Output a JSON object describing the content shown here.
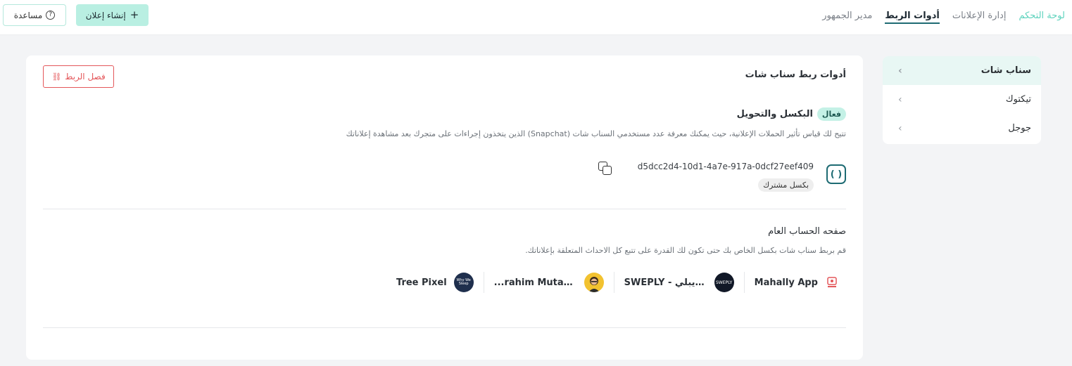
{
  "nav": {
    "items": [
      {
        "label": "لوحة التحكم"
      },
      {
        "label": "إدارة الإعلانات"
      },
      {
        "label": "أدوات الربط"
      },
      {
        "label": "مدير الجمهور"
      }
    ],
    "create_label": "إنشاء إعلان",
    "help_label": "مساعدة"
  },
  "sidebar": {
    "items": [
      {
        "label": "سناب شات"
      },
      {
        "label": "تيكتوك"
      },
      {
        "label": "جوجل"
      }
    ]
  },
  "panel": {
    "title": "أدوات ربط سناب شات",
    "unlink_label": "فصل الربط",
    "pixel": {
      "title": "البكسل والتحويل",
      "status": "فعال",
      "description": "تتيح لك قياس تأثير الحملات الإعلانية، حيث يمكنك معرفة عدد مستخدمي السناب شات (Snapchat) الذين يتخذون إجراءات على متجرك بعد مشاهدة إعلاناتك",
      "id": "d5dcc2d4-10d1-4a7e-917a-0dcf27eef409",
      "shared_badge": "بكسل مشترك"
    },
    "public_account": {
      "title": "صفحه الحساب العام",
      "description": "قم بربط سناب شات بكسل الخاص بك حتى تكون لك القدرة على تتبع كل الاحداث المتعلقة بإعلاناتك.",
      "accounts": [
        {
          "name": "Mahally App",
          "avatar_text": ""
        },
        {
          "name": "SWEPLY - سويبلي",
          "avatar_text": "SWEPLY"
        },
        {
          "name": "...rahim Mutahar",
          "avatar_text": ""
        },
        {
          "name": "Tree Pixel",
          "avatar_text": "Why We Sleep"
        }
      ]
    }
  },
  "colors": {
    "brand": "#5dd3bd",
    "accent": "#1e6b73",
    "danger": "#e4575a",
    "active_badge_bg": "#c4f1e6"
  },
  "icons": {
    "plus": "+",
    "help": "?",
    "chevron": "‹",
    "pixel": "( )",
    "unlink": "⛓"
  }
}
